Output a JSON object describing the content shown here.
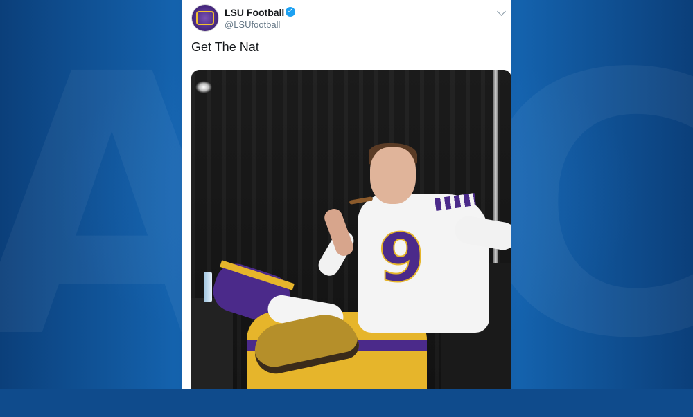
{
  "tweet": {
    "display_name": "LSU Football",
    "verified_icon": "verified-badge-icon",
    "handle": "@LSUfootball",
    "text": "Get The Nat",
    "menu_icon": "chevron-down-icon"
  },
  "media": {
    "jersey_number": "9"
  },
  "colors": {
    "background": "#0f4b8c",
    "card": "#ffffff",
    "verified": "#1da1f2",
    "lsu_purple": "#4b2a8a",
    "lsu_gold": "#e6b52b"
  }
}
